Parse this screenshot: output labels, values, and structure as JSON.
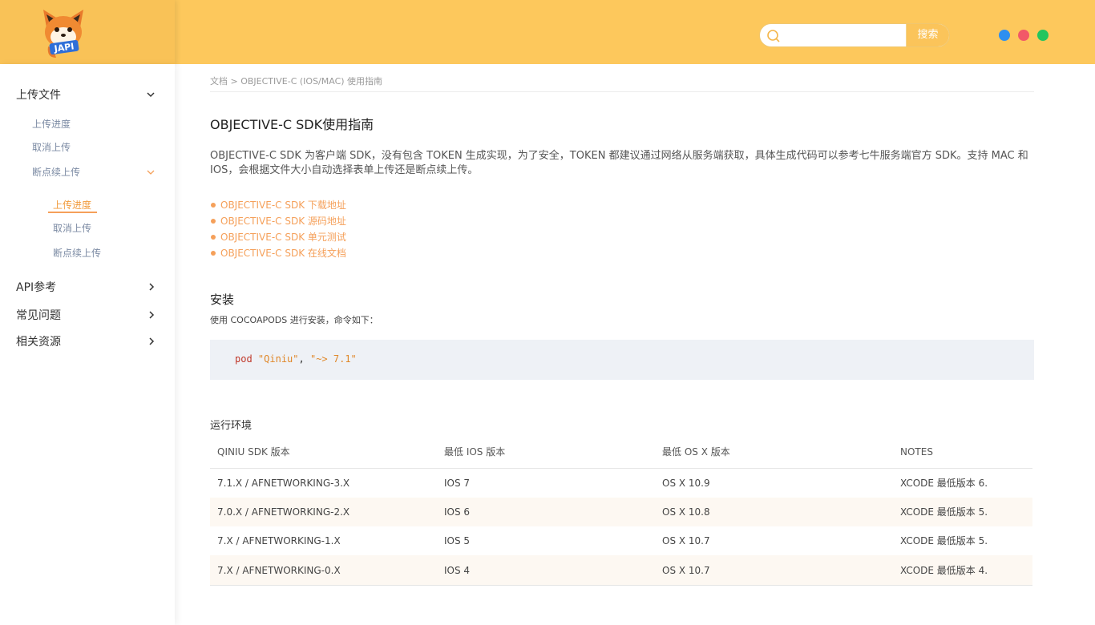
{
  "header": {
    "logo_text": "JAPI",
    "search_placeholder": "",
    "search_button": "搜索",
    "window_dots": [
      "#2e8ff0",
      "#f25868",
      "#22c55e"
    ]
  },
  "sidebar": {
    "groups": [
      {
        "label": "上传文件",
        "expanded": true
      },
      {
        "label": "API参考",
        "expanded": false
      },
      {
        "label": "常见问题",
        "expanded": false
      },
      {
        "label": "相关资源",
        "expanded": false
      }
    ],
    "sub_items": [
      "上传进度",
      "取消上传",
      "断点续上传"
    ],
    "nested_items": [
      "上传进度",
      "取消上传",
      "断点续上传"
    ],
    "active_item": "上传进度"
  },
  "main": {
    "breadcrumb": "文档 > OBJECTIVE-C (IOS/MAC) 使用指南",
    "title": "OBJECTIVE-C SDK使用指南",
    "intro": "OBJECTIVE-C SDK 为客户端 SDK，没有包含 TOKEN 生成实现，为了安全，TOKEN 都建议通过网络从服务端获取，具体生成代码可以参考七牛服务端官方 SDK。支持 MAC 和 IOS，会根据文件大小自动选择表单上传还是断点续上传。",
    "links": [
      "OBJECTIVE-C SDK 下载地址",
      "OBJECTIVE-C SDK 源码地址",
      "OBJECTIVE-C SDK 单元测试",
      "OBJECTIVE-C SDK 在线文档"
    ],
    "install_heading": "安装",
    "install_desc": "使用 COCOAPODS 进行安装，命令如下：",
    "code": {
      "keyword": "pod",
      "arg1": "\"Qiniu\"",
      "sep": ",",
      "arg2": "\"~> 7.1\""
    },
    "env_heading": "运行环境",
    "table": {
      "headers": [
        "QINIU SDK 版本",
        "最低 IOS 版本",
        "最低 OS X 版本",
        "NOTES"
      ],
      "rows": [
        [
          "7.1.X / AFNETWORKING-3.X",
          "IOS 7",
          "OS X 10.9",
          "XCODE 最低版本 6."
        ],
        [
          "7.0.X / AFNETWORKING-2.X",
          "IOS 6",
          "OS X 10.8",
          "XCODE 最低版本 5."
        ],
        [
          "7.X / AFNETWORKING-1.X",
          "IOS 5",
          "OS X 10.7",
          "XCODE 最低版本 5."
        ],
        [
          "7.X / AFNETWORKING-0.X",
          "IOS 4",
          "OS X 10.7",
          "XCODE 最低版本 4."
        ]
      ]
    }
  }
}
